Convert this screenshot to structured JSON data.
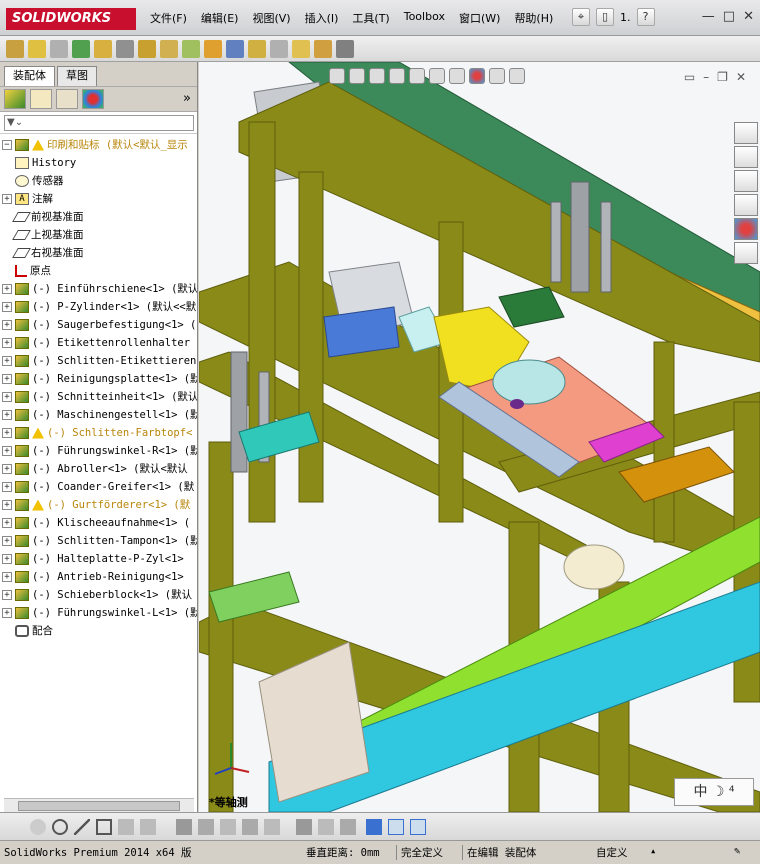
{
  "app": {
    "logo_text": "SOLIDWORKS"
  },
  "menu": [
    "文件(F)",
    "编辑(E)",
    "视图(V)",
    "插入(I)",
    "工具(T)",
    "Toolbox",
    "窗口(W)",
    "帮助(H)"
  ],
  "title_fragment": "1.",
  "window_controls": [
    "—",
    "□",
    "✕"
  ],
  "panel_tabs": {
    "assembly": "装配体",
    "sketch": "草图"
  },
  "tree": {
    "root": "印刷和贴标  (默认<默认_显示",
    "items": [
      {
        "label": "History",
        "icon": "history-icon"
      },
      {
        "label": "传感器",
        "icon": "sensor-icon"
      },
      {
        "label": "注解",
        "icon": "annotation-icon"
      },
      {
        "label": "前视基准面",
        "icon": "plane-icon"
      },
      {
        "label": "上视基准面",
        "icon": "plane-icon"
      },
      {
        "label": "右视基准面",
        "icon": "plane-icon"
      },
      {
        "label": "原点",
        "icon": "origin-icon"
      },
      {
        "label": "(-) Einführschiene<1> (默认",
        "icon": "part-icon"
      },
      {
        "label": "(-) P-Zylinder<1> (默认<<默",
        "icon": "part-icon"
      },
      {
        "label": "(-) Saugerbefestigung<1> (",
        "icon": "part-icon"
      },
      {
        "label": "(-) Etikettenrollenhalter",
        "icon": "part-icon"
      },
      {
        "label": "(-) Schlitten-Etikettieren",
        "icon": "part-icon"
      },
      {
        "label": "(-) Reinigungsplatte<1> (默",
        "icon": "part-icon"
      },
      {
        "label": "(-) Schnitteinheit<1> (默认",
        "icon": "part-icon"
      },
      {
        "label": "(-) Maschinengestell<1> (默",
        "icon": "part-icon"
      },
      {
        "label": "(-) Schlitten-Farbtopf<",
        "icon": "part-warning-icon",
        "warn": true
      },
      {
        "label": "(-) Führungswinkel-R<1> (默",
        "icon": "part-icon"
      },
      {
        "label": "(-) Abroller<1> (默认<默认",
        "icon": "part-icon"
      },
      {
        "label": "(-) Coander-Greifer<1> (默",
        "icon": "part-icon"
      },
      {
        "label": "(-) Gurtförderer<1> (默",
        "icon": "part-warning-icon",
        "warn": true
      },
      {
        "label": "(-) Klischeeaufnahme<1> (",
        "icon": "part-icon"
      },
      {
        "label": "(-) Schlitten-Tampon<1> (默",
        "icon": "part-icon"
      },
      {
        "label": "(-) Halteplatte-P-Zyl<1>",
        "icon": "part-icon"
      },
      {
        "label": "(-) Antrieb-Reinigung<1>",
        "icon": "part-icon"
      },
      {
        "label": "(-) Schieberblock<1> (默认",
        "icon": "part-icon"
      },
      {
        "label": "(-) Führungswinkel-L<1> (默",
        "icon": "part-icon"
      },
      {
        "label": "配合",
        "icon": "mate-icon"
      }
    ]
  },
  "viewport": {
    "view_label": "*等轴测"
  },
  "ime": "中 ☽ ⁴",
  "status": {
    "product": "SolidWorks Premium 2014 x64 版",
    "distance": "垂直距离: 0mm",
    "defined": "完全定义",
    "editing": "在编辑 装配体",
    "custom": "自定义"
  },
  "colors": {
    "frame": "#8a8a18",
    "frame_dark": "#5e5e0c",
    "belt_green": "#3c8a5a",
    "cyan": "#30c8e0",
    "yellow": "#f0e020",
    "salmon": "#f49a80",
    "orange": "#d4920c",
    "lime": "#90e030"
  }
}
